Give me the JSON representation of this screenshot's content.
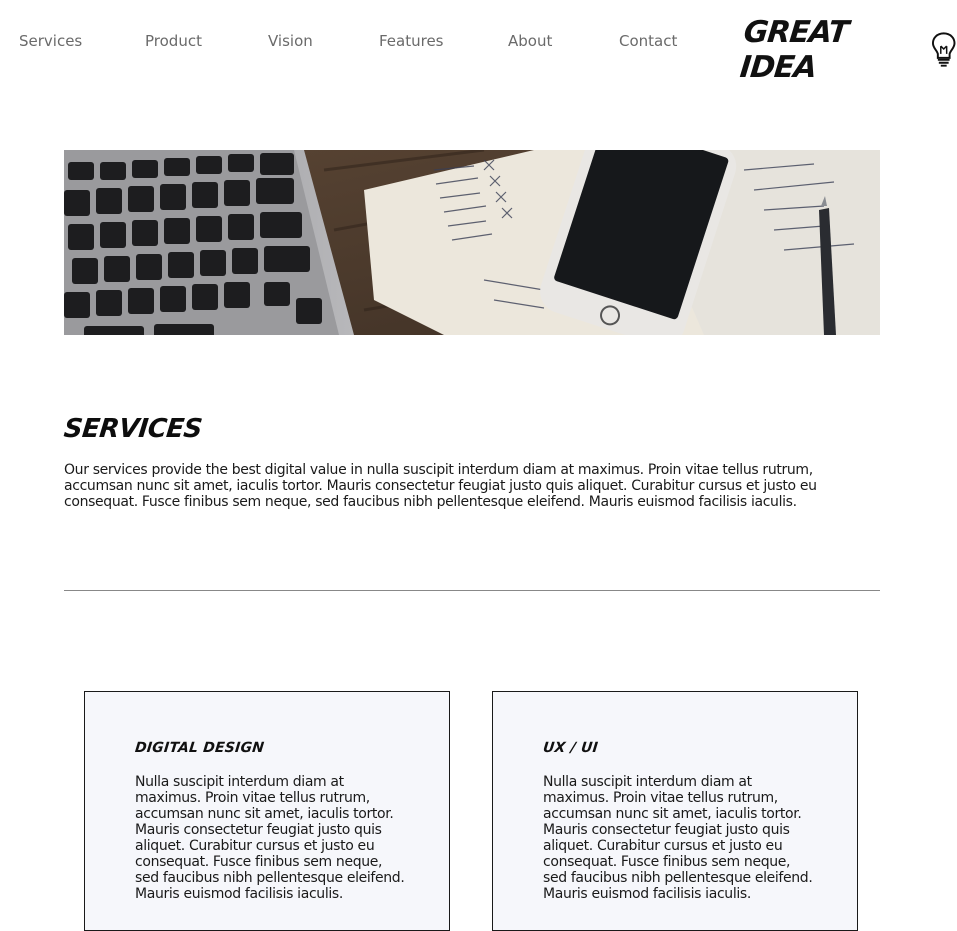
{
  "nav": {
    "items": [
      "Services",
      "Product",
      "Vision",
      "Features",
      "About",
      "Contact"
    ],
    "logo": "GREAT IDEA"
  },
  "hero": {
    "icon": "photo-laptop-phone-notebook"
  },
  "services": {
    "title": "SERVICES",
    "body": "Our services provide the best digital value in nulla suscipit interdum diam at maximus. Proin vitae tellus rutrum, accumsan nunc sit amet, iaculis tortor. Mauris consectetur feugiat justo quis aliquet. Curabitur cursus et justo eu consequat. Fusce finibus sem neque, sed faucibus nibh pellentesque eleifend. Mauris euismod facilisis iaculis."
  },
  "cards": [
    {
      "title": "DIGITAL DESIGN",
      "body": "Nulla suscipit interdum diam at maximus. Proin vitae tellus rutrum, accumsan nunc sit amet, iaculis tortor. Mauris consectetur feugiat justo quis aliquet. Curabitur cursus et justo eu consequat. Fusce finibus sem neque, sed faucibus nibh pellentesque eleifend. Mauris euismod facilisis iaculis."
    },
    {
      "title": "UX / UI",
      "body": "Nulla suscipit interdum diam at maximus. Proin vitae tellus rutrum, accumsan nunc sit amet, iaculis tortor. Mauris consectetur feugiat justo quis aliquet. Curabitur cursus et justo eu consequat. Fusce finibus sem neque, sed faucibus nibh pellentesque eleifend. Mauris euismod facilisis iaculis."
    }
  ],
  "colors": {
    "nav_text": "#6a6a6a",
    "card_bg": "#f6f7fb",
    "divider": "#888888"
  }
}
